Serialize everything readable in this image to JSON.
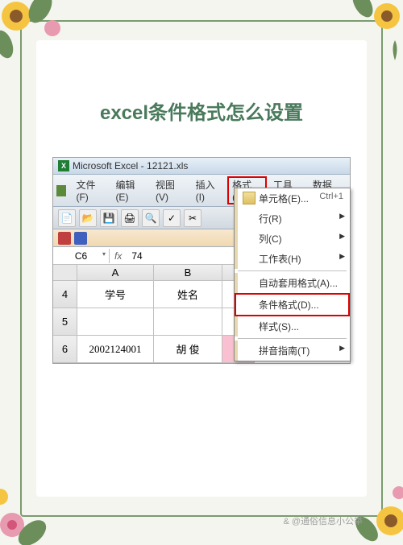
{
  "page_title": "excel条件格式怎么设置",
  "excel": {
    "window_title": "Microsoft Excel - 12121.xls",
    "menus": {
      "file": "文件(F)",
      "edit": "编辑(E)",
      "view": "视图(V)",
      "insert": "插入(I)",
      "format": "格式(O)",
      "tools": "工具(T)",
      "data": "数据(D)"
    },
    "name_box": "C6",
    "formula_fx": "fx",
    "formula_value": "74",
    "columns": [
      "A",
      "B"
    ],
    "rows": [
      "4",
      "5",
      "6"
    ],
    "cells": {
      "A4": "学号",
      "B4": "姓名",
      "A6": "2002124001",
      "B6": "胡 俊"
    }
  },
  "dropdown": {
    "cells": "单元格(E)...",
    "cells_shortcut": "Ctrl+1",
    "row": "行(R)",
    "column": "列(C)",
    "sheet": "工作表(H)",
    "autoformat": "自动套用格式(A)...",
    "conditional": "条件格式(D)...",
    "style": "样式(S)...",
    "phonetic": "拼音指南(T)"
  },
  "watermark": "& @通俗信息小公举"
}
